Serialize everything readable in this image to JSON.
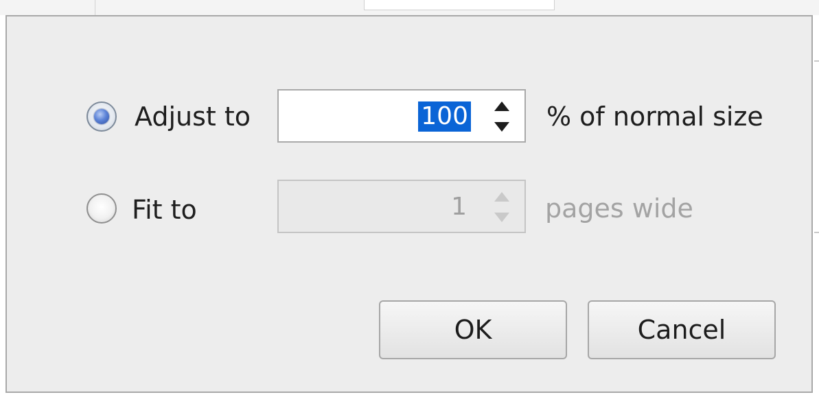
{
  "scale": {
    "adjust": {
      "label": "Adjust to",
      "selected": true,
      "value": "100",
      "suffix": "% of normal size"
    },
    "fit": {
      "label": "Fit to",
      "selected": false,
      "value": "1",
      "suffix": "pages wide",
      "disabled": true
    }
  },
  "buttons": {
    "ok_label": "OK",
    "cancel_label": "Cancel"
  },
  "icons": {
    "radio_selected": "radio-selected-icon",
    "radio_unselected": "radio-unselected-icon",
    "spin_up": "arrow-up-icon",
    "spin_down": "arrow-down-icon"
  },
  "colors": {
    "dialog_bg": "#ededed",
    "selection": "#0a64d6",
    "disabled_text": "#9f9f9f"
  }
}
